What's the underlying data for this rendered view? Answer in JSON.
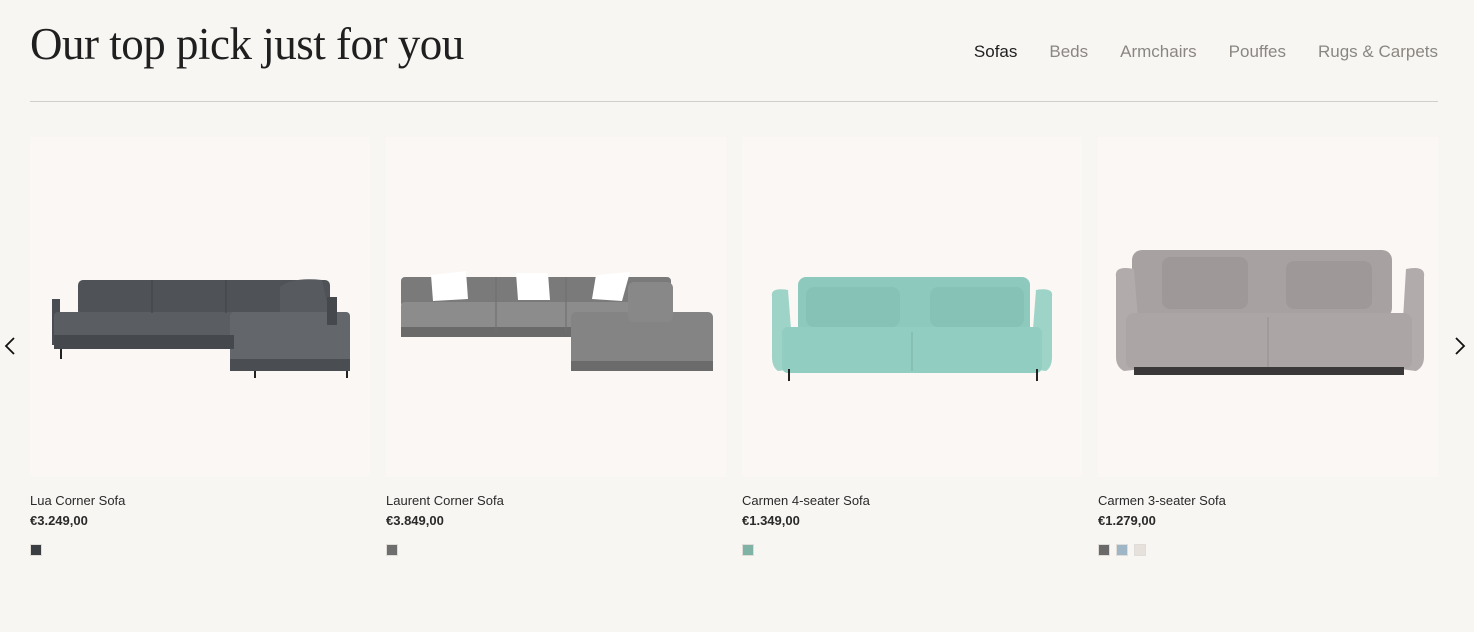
{
  "section": {
    "title": "Our top pick just for you"
  },
  "tabs": [
    {
      "label": "Sofas",
      "active": true
    },
    {
      "label": "Beds",
      "active": false
    },
    {
      "label": "Armchairs",
      "active": false
    },
    {
      "label": "Pouffes",
      "active": false
    },
    {
      "label": "Rugs & Carpets",
      "active": false
    }
  ],
  "carousel": {
    "prev_icon": "chevron-left-icon",
    "next_icon": "chevron-right-icon"
  },
  "products": [
    {
      "name": "Lua Corner Sofa",
      "price": "€3.249,00",
      "swatches": [
        "#3a3d42"
      ]
    },
    {
      "name": "Laurent Corner Sofa",
      "price": "€3.849,00",
      "swatches": [
        "#6e6e6e"
      ]
    },
    {
      "name": "Carmen 4-seater Sofa",
      "price": "€1.349,00",
      "swatches": [
        "#7fb3a6"
      ]
    },
    {
      "name": "Carmen 3-seater Sofa",
      "price": "€1.279,00",
      "swatches": [
        "#6a6a6a",
        "#9fb6c6",
        "#e6e1da"
      ]
    }
  ]
}
